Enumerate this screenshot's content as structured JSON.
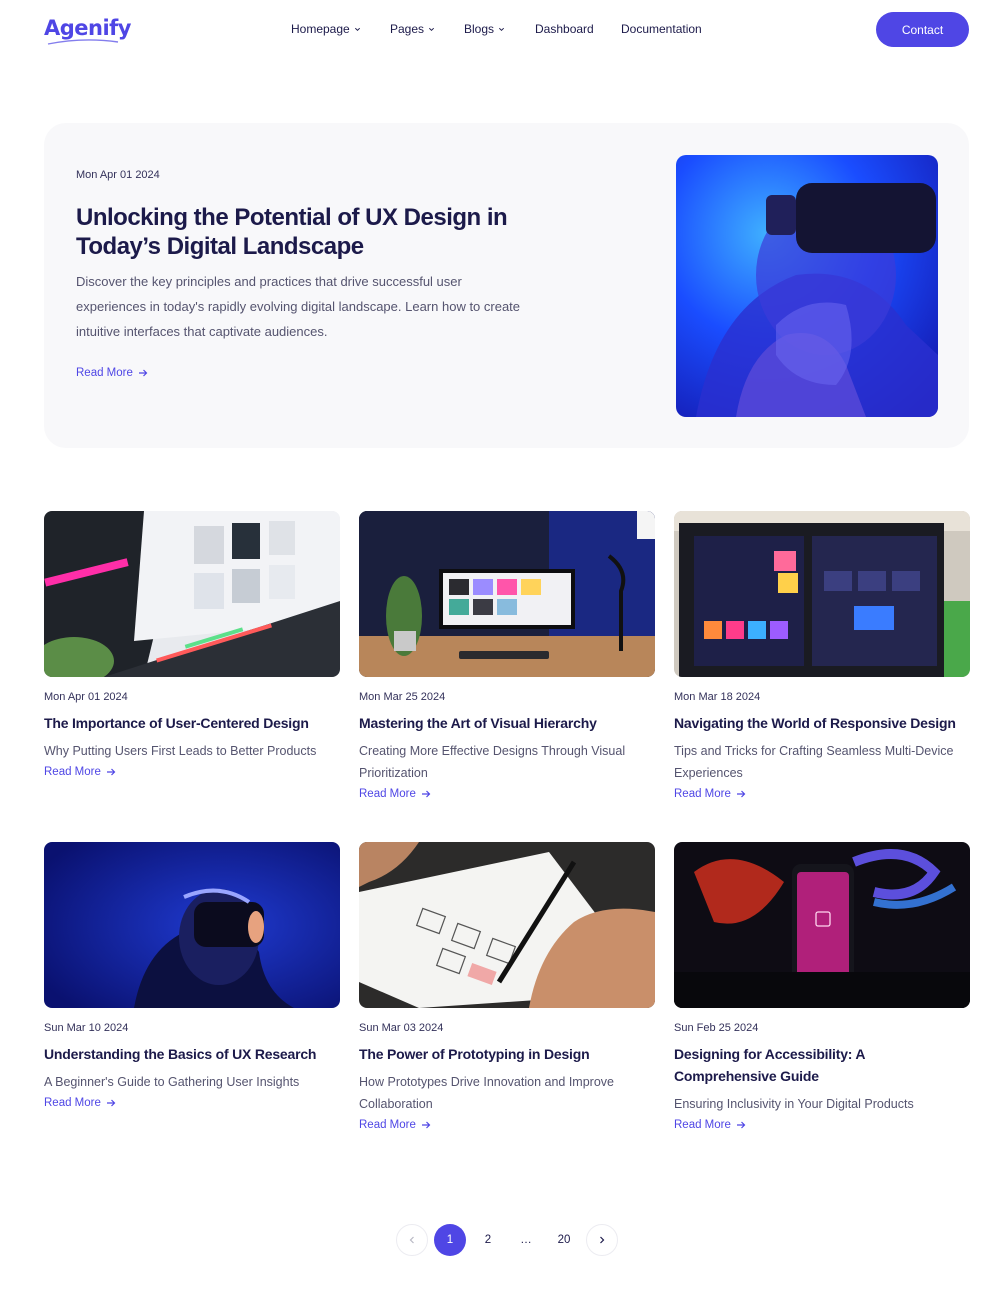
{
  "brand": {
    "logo": "Agenify",
    "accent": "#4f46e5"
  },
  "nav": {
    "items": [
      {
        "label": "Homepage",
        "dropdown": true
      },
      {
        "label": "Pages",
        "dropdown": true
      },
      {
        "label": "Blogs",
        "dropdown": true
      },
      {
        "label": "Dashboard",
        "dropdown": false
      },
      {
        "label": "Documentation",
        "dropdown": false
      }
    ],
    "contact_label": "Contact"
  },
  "hero": {
    "date": "Mon Apr 01 2024",
    "title": "Unlocking the Potential of UX Design in Today’s Digital Landscape",
    "description": "Discover the key principles and practices that drive successful user experiences in today's rapidly evolving digital landscape. Learn how to create intuitive interfaces that captivate audiences.",
    "read_more": "Read More",
    "image": "person-wearing-vr-headset-blue-light"
  },
  "posts": [
    {
      "date": "Mon Apr 01 2024",
      "title": "The Importance of User-Centered Design",
      "subtitle": "Why Putting Users First Leads to Better Products",
      "read_more": "Read More",
      "image": "laptop-design-app"
    },
    {
      "date": "Mon Mar 25 2024",
      "title": "Mastering the Art of Visual Hierarchy",
      "subtitle": "Creating More Effective Designs Through Visual Prioritization",
      "read_more": "Read More",
      "image": "desk-monitor-setup"
    },
    {
      "date": "Mon Mar 18 2024",
      "title": "Navigating the World of Responsive Design",
      "subtitle": "Tips and Tricks for Crafting Seamless Multi-Device Experiences",
      "read_more": "Read More",
      "image": "monitor-design-software"
    },
    {
      "date": "Sun Mar 10 2024",
      "title": "Understanding the Basics of UX Research",
      "subtitle": "A Beginner's Guide to Gathering User Insights",
      "read_more": "Read More",
      "image": "man-vr-headset-dark-blue"
    },
    {
      "date": "Sun Mar 03 2024",
      "title": "The Power of Prototyping in Design",
      "subtitle": "How Prototypes Drive Innovation and Improve Collaboration",
      "read_more": "Read More",
      "image": "hand-sketching-wireframes"
    },
    {
      "date": "Sun Feb 25 2024",
      "title": "Designing for Accessibility: A Comprehensive Guide",
      "subtitle": "Ensuring Inclusivity in Your Digital Products",
      "read_more": "Read More",
      "image": "phone-adobe-xd-neon"
    }
  ],
  "pagination": {
    "pages": [
      "1",
      "2",
      "…",
      "20"
    ],
    "current": "1"
  }
}
